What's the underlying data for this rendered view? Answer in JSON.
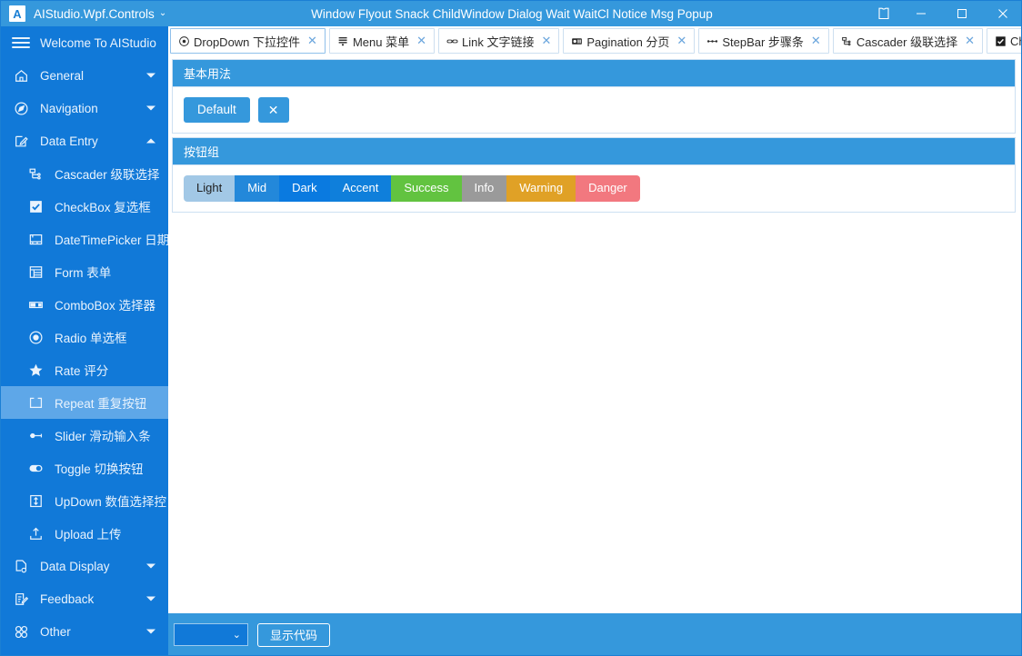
{
  "titlebar": {
    "logo_text": "A",
    "app_title": "AIStudio.Wpf.Controls",
    "app_chevron": "⌄",
    "center_title": "Window Flyout Snack ChildWindow Dialog Wait WaitCl Notice Msg Popup",
    "theme_icon": "shirt-icon",
    "minimize": "—",
    "maximize": "□",
    "close": "✕"
  },
  "sidebar": {
    "header_label": "Welcome To AIStudio",
    "items": [
      {
        "label": "General",
        "icon": "home-icon",
        "level": "top",
        "expanded": false,
        "selected": false
      },
      {
        "label": "Navigation",
        "icon": "compass-icon",
        "level": "top",
        "expanded": false,
        "selected": false
      },
      {
        "label": "Data Entry",
        "icon": "edit-square-icon",
        "level": "top",
        "expanded": true,
        "selected": false
      },
      {
        "label": "Cascader 级联选择",
        "icon": "cascader-icon",
        "level": "child",
        "selected": false
      },
      {
        "label": "CheckBox 复选框",
        "icon": "checkbox-icon",
        "level": "child",
        "selected": false
      },
      {
        "label": "DateTimePicker 日期",
        "icon": "calendar-icon",
        "level": "child",
        "selected": false
      },
      {
        "label": "Form 表单",
        "icon": "form-grid-icon",
        "level": "child",
        "selected": false
      },
      {
        "label": "ComboBox 选择器",
        "icon": "combobox-icon",
        "level": "child",
        "selected": false
      },
      {
        "label": "Radio 单选框",
        "icon": "radio-icon",
        "level": "child",
        "selected": false
      },
      {
        "label": "Rate 评分",
        "icon": "star-icon",
        "level": "child",
        "selected": false
      },
      {
        "label": "Repeat 重复按钮",
        "icon": "repeat-icon",
        "level": "child",
        "selected": true
      },
      {
        "label": "Slider 滑动输入条",
        "icon": "slider-icon",
        "level": "child",
        "selected": false
      },
      {
        "label": "Toggle 切换按钮",
        "icon": "toggle-icon",
        "level": "child",
        "selected": false
      },
      {
        "label": "UpDown 数值选择控",
        "icon": "updown-icon",
        "level": "child",
        "selected": false
      },
      {
        "label": "Upload 上传",
        "icon": "upload-icon",
        "level": "child",
        "selected": false
      },
      {
        "label": "Data Display",
        "icon": "data-display-icon",
        "level": "top",
        "expanded": false,
        "selected": false
      },
      {
        "label": "Feedback",
        "icon": "feedback-icon",
        "level": "top",
        "expanded": false,
        "selected": false
      },
      {
        "label": "Other",
        "icon": "grid-four-icon",
        "level": "top",
        "expanded": false,
        "selected": false
      }
    ]
  },
  "tabs": [
    {
      "label": "DropDown 下拉控件",
      "icon": "target-icon",
      "closable": true,
      "active": true
    },
    {
      "label": "Menu 菜单",
      "icon": "menu-icon",
      "closable": true,
      "active": false
    },
    {
      "label": "Link 文字链接",
      "icon": "link-icon",
      "closable": true,
      "active": false
    },
    {
      "label": "Pagination 分页",
      "icon": "pagination-icon",
      "closable": true,
      "active": false
    },
    {
      "label": "StepBar 步骤条",
      "icon": "stepbar-icon",
      "closable": true,
      "active": false
    },
    {
      "label": "Cascader 级联选择",
      "icon": "cascader-icon",
      "closable": true,
      "active": false
    },
    {
      "label": "CheckI",
      "icon": "checkbox-filled-icon",
      "closable": false,
      "chevron": "⌄",
      "active": false
    }
  ],
  "cards": [
    {
      "title": "基本用法",
      "buttons": [
        {
          "label": "Default",
          "color": "#3598dc"
        },
        {
          "label": "✕",
          "color": "#3598dc",
          "icon_only": true
        }
      ]
    },
    {
      "title": "按钮组",
      "group": [
        {
          "label": "Light",
          "bg": "#a2c8e6",
          "fg": "#1d1d1d"
        },
        {
          "label": "Mid",
          "bg": "#2388da",
          "fg": "#ffffff"
        },
        {
          "label": "Dark",
          "bg": "#0a7ae0",
          "fg": "#ffffff"
        },
        {
          "label": "Accent",
          "bg": "#0f7fdb",
          "fg": "#ffffff"
        },
        {
          "label": "Success",
          "bg": "#62c340",
          "fg": "#ffffff"
        },
        {
          "label": "Info",
          "bg": "#9a9a9a",
          "fg": "#ffffff"
        },
        {
          "label": "Warning",
          "bg": "#e0a126",
          "fg": "#ffffff"
        },
        {
          "label": "Danger",
          "bg": "#f2787f",
          "fg": "#ffffff"
        }
      ]
    }
  ],
  "bottombar": {
    "combo_value": "",
    "combo_chevron": "⌄",
    "show_code_label": "显示代码"
  },
  "colors": {
    "accent": "#3598dc",
    "sidebar": "#1179d8",
    "sidebar_selected": "#5ea7e8",
    "panel_border": "#cde0f2"
  }
}
